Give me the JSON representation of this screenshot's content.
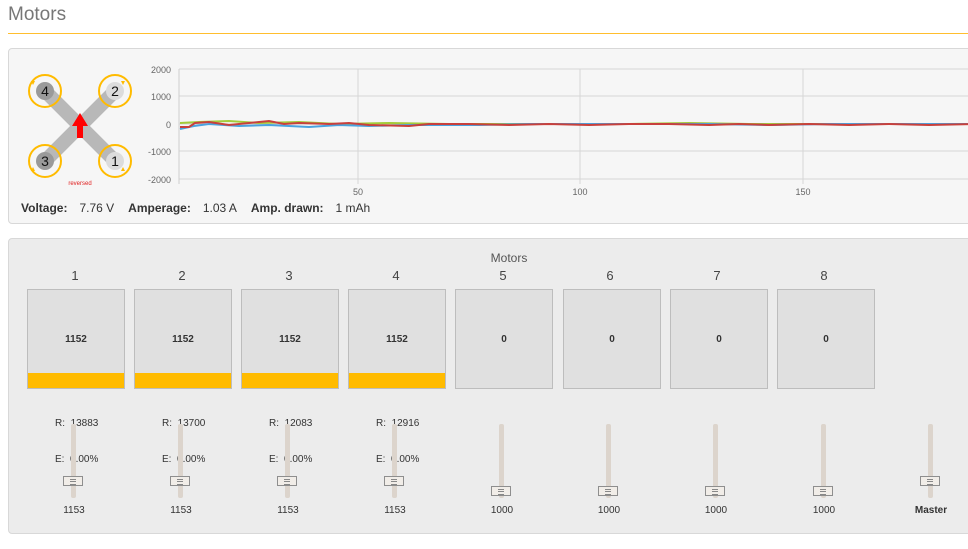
{
  "header": {
    "title": "Motors"
  },
  "quad": {
    "props": [
      "4",
      "2",
      "3",
      "1"
    ],
    "reversed_label": "reversed"
  },
  "graph": {
    "y_ticks": [
      "2000",
      "1000",
      "0",
      "-1000",
      "-2000"
    ],
    "x_ticks": [
      "50",
      "100",
      "150"
    ]
  },
  "power": {
    "voltage_label": "Voltage:",
    "voltage_value": "7.76 V",
    "amperage_label": "Amperage:",
    "amperage_value": "1.03 A",
    "drawn_label": "Amp. drawn:",
    "drawn_value": "1 mAh"
  },
  "motors": {
    "title": "Motors",
    "items": [
      {
        "num": "1",
        "value": "1152",
        "active": true,
        "rpm": "13883",
        "err": "0.00%",
        "slider": "1153"
      },
      {
        "num": "2",
        "value": "1152",
        "active": true,
        "rpm": "13700",
        "err": "0.00%",
        "slider": "1153"
      },
      {
        "num": "3",
        "value": "1152",
        "active": true,
        "rpm": "12083",
        "err": "0.00%",
        "slider": "1153"
      },
      {
        "num": "4",
        "value": "1152",
        "active": true,
        "rpm": "12916",
        "err": "0.00%",
        "slider": "1153"
      },
      {
        "num": "5",
        "value": "0",
        "active": false,
        "slider": "1000"
      },
      {
        "num": "6",
        "value": "0",
        "active": false,
        "slider": "1000"
      },
      {
        "num": "7",
        "value": "0",
        "active": false,
        "slider": "1000"
      },
      {
        "num": "8",
        "value": "0",
        "active": false,
        "slider": "1000"
      }
    ],
    "master_label": "Master"
  },
  "colors": {
    "accent": "#ffbb00",
    "motor_bar": "#ffbb00",
    "arrow": "#ff0000"
  }
}
